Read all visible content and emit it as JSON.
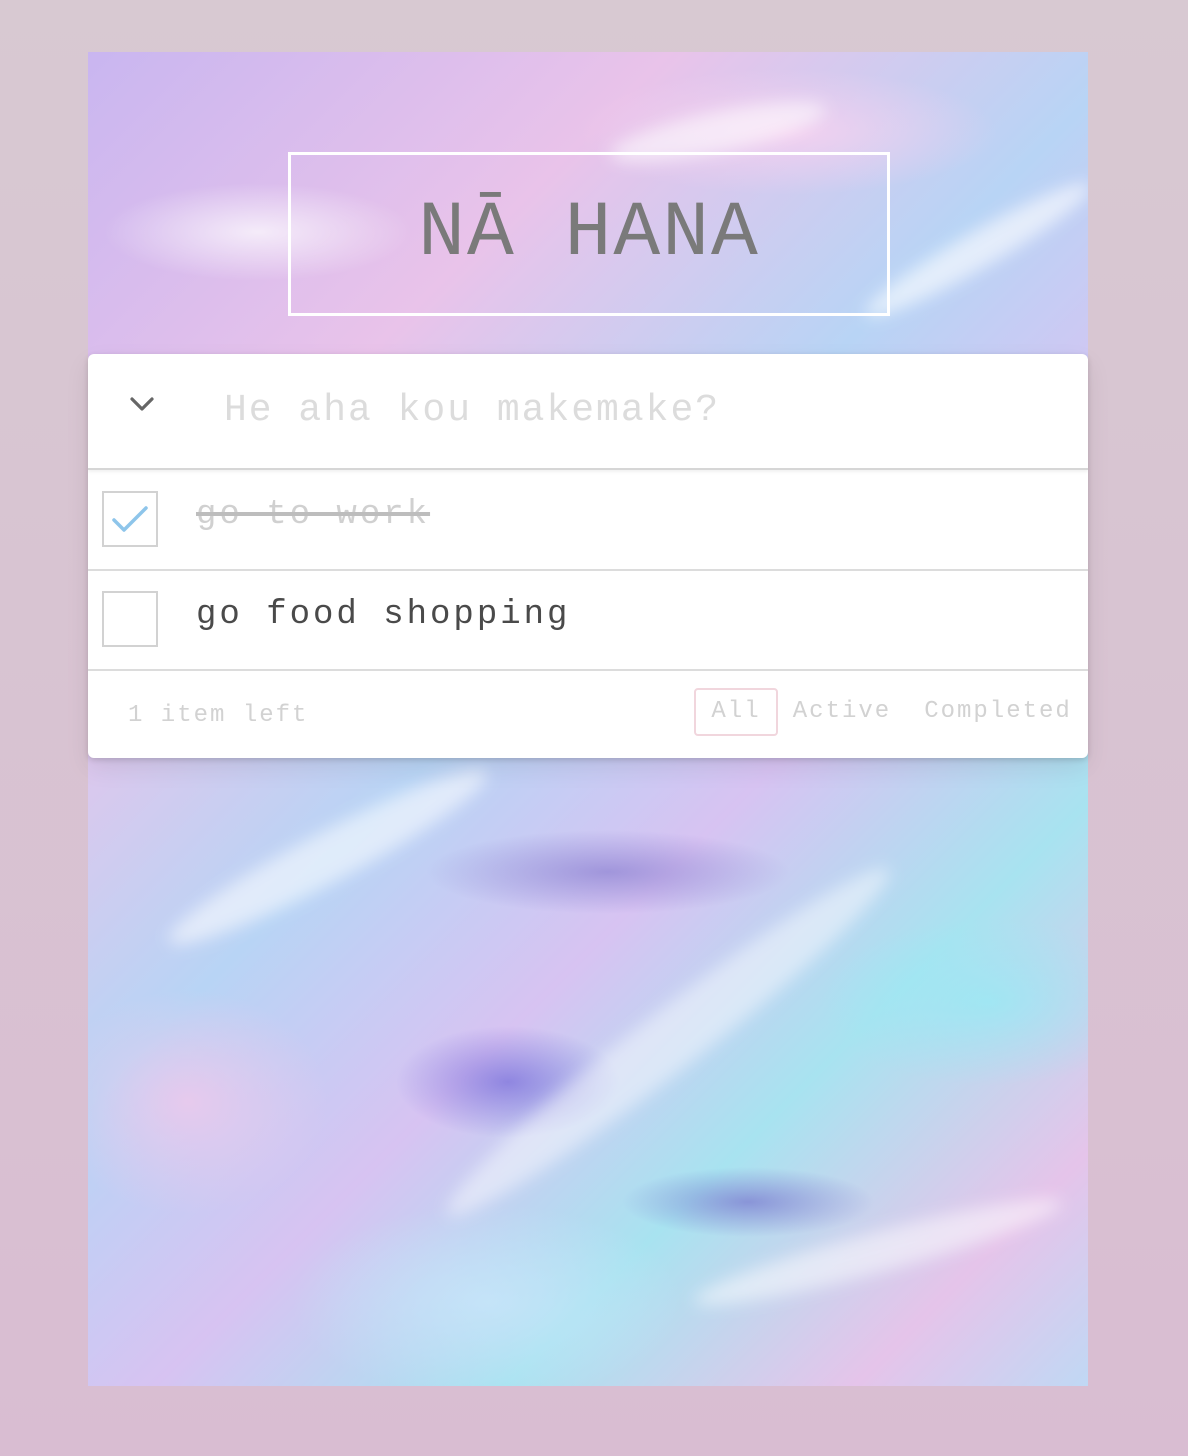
{
  "app": {
    "title": "NĀ HANA"
  },
  "new_todo": {
    "placeholder": "He aha kou makemake?",
    "value": ""
  },
  "todos": [
    {
      "label": "go to work",
      "completed": true
    },
    {
      "label": "go food shopping",
      "completed": false
    }
  ],
  "footer": {
    "count_text": "1 item left",
    "filters": [
      {
        "label": "All",
        "selected": true
      },
      {
        "label": "Active",
        "selected": false
      },
      {
        "label": "Completed",
        "selected": false
      }
    ]
  },
  "icons": {
    "toggle_all": "chevron-down-icon",
    "check": "checkmark-icon"
  },
  "colors": {
    "page_background": "#d9c4d2",
    "check_mark": "#8ec5ea",
    "selected_filter_border": "#f1d6dd",
    "title_text": "#7a7a7a"
  }
}
